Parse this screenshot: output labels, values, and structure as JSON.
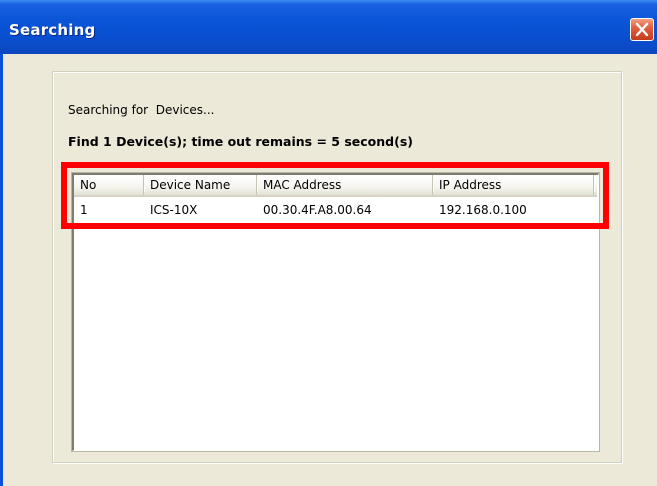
{
  "window": {
    "title": "Searching",
    "close_icon": "close-x-icon"
  },
  "status": {
    "searching_text": "Searching for  Devices...",
    "find_text": "Find 1 Device(s); time out remains = 5 second(s)"
  },
  "table": {
    "columns": [
      "No",
      "Device Name",
      "MAC Address",
      "IP Address"
    ],
    "rows": [
      {
        "no": "1",
        "device_name": "ICS-10X",
        "mac": "00.30.4F.A8.00.64",
        "ip": "192.168.0.100"
      }
    ]
  },
  "colors": {
    "titlebar": "#0a55d8",
    "dialog_bg": "#ece9d8",
    "highlight": "#ff0000",
    "close_button": "#e06040"
  }
}
